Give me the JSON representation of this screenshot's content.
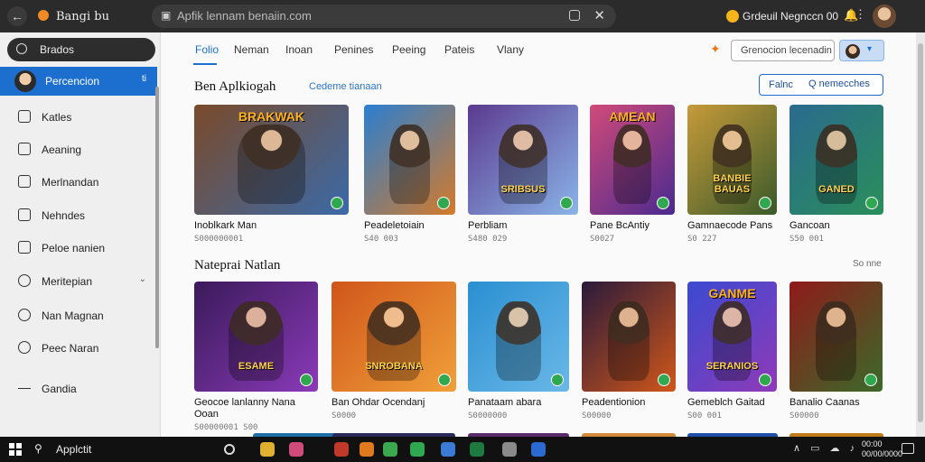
{
  "topbar": {
    "title": "Bangi  bu",
    "address": "Apfik lennam benaiin.com",
    "account": "Grdeuil Negnccn 00"
  },
  "sidebar": {
    "search": "Brados",
    "active": {
      "label": "Percencion",
      "badge": "ti"
    },
    "items": [
      {
        "label": "Katles"
      },
      {
        "label": "Aeaning"
      },
      {
        "label": "Merlnandan"
      },
      {
        "label": "Nehndes"
      },
      {
        "label": "Peloe nanien"
      },
      {
        "label": "Meritepian"
      },
      {
        "label": "Nan Magnan"
      },
      {
        "label": "Peec Naran"
      },
      {
        "label": "Gandia"
      }
    ]
  },
  "tabs": [
    "Folio",
    "Neman",
    "Inoan",
    "Penines",
    "Peeing",
    "Pateis",
    "Vlany"
  ],
  "header": {
    "search": "Grenocion lecenadin",
    "filter_label": "Falnc",
    "filter_value": "Q  nemecches"
  },
  "sections": [
    {
      "title": "Ben Aplkiogah",
      "subtitle": "Cedeme tianaan",
      "more": "",
      "cards": [
        {
          "name": "Inoblkark Man",
          "meta": "S000000001",
          "banner": "BRAKWAK",
          "art": "",
          "colors": [
            "#7a4a2a",
            "#3b6aa8"
          ]
        },
        {
          "name": "Peadeletoiain",
          "meta": "S40 003",
          "banner": "",
          "art": "",
          "colors": [
            "#2a7fd1",
            "#d47a2a"
          ]
        },
        {
          "name": "Perbliam",
          "meta": "S480 029",
          "banner": "",
          "art": "SRIBSUS",
          "colors": [
            "#5b3a8f",
            "#8ab4e8"
          ]
        },
        {
          "name": "Pane BcAntiy",
          "meta": "S0027",
          "banner": "AMEAN",
          "art": "",
          "colors": [
            "#d04a7a",
            "#4a2a8f"
          ]
        },
        {
          "name": "Gamnaecode Pans",
          "meta": "S0 227",
          "banner": "",
          "art": "BANBIE BAUAS",
          "colors": [
            "#c79a3a",
            "#3a5a2a"
          ]
        },
        {
          "name": "Gancoan",
          "meta": "S50 001",
          "banner": "",
          "art": "GANED",
          "colors": [
            "#2a6a8f",
            "#2a8f5a"
          ]
        }
      ]
    },
    {
      "title": "Nateprai Natlan",
      "subtitle": "",
      "more": "So nne",
      "cards": [
        {
          "name": "Geocoe lanlanny Nana Ooan",
          "meta": "S00000001 S00",
          "banner": "",
          "art": "ESAME",
          "colors": [
            "#3a1a5a",
            "#8a3ab8"
          ]
        },
        {
          "name": "Ban Ohdar Ocendanj",
          "meta": "S0000",
          "banner": "",
          "art": "SNROBANA",
          "colors": [
            "#d0561a",
            "#f0a03a"
          ]
        },
        {
          "name": "Panataam abara",
          "meta": "S0000000",
          "banner": "",
          "art": "",
          "colors": [
            "#2a8fd1",
            "#6ab8e8"
          ]
        },
        {
          "name": "Peadentionion",
          "meta": "S00000",
          "banner": "",
          "art": "",
          "colors": [
            "#2a1a3a",
            "#d0561a"
          ]
        },
        {
          "name": "Gemeblch Gaitad",
          "meta": "S00 001",
          "banner": "GANME",
          "art": "SERANIOS",
          "colors": [
            "#3a4ad1",
            "#8f3ab8"
          ]
        },
        {
          "name": "Banalio Caanas",
          "meta": "S00000",
          "banner": "",
          "art": "",
          "colors": [
            "#8f1a1a",
            "#3a6a2a"
          ]
        }
      ]
    }
  ],
  "taskbar": {
    "search": "Applctit",
    "clock_time": "00:00",
    "clock_date": "00/00/0000",
    "apps": [
      "#2d6cd1",
      "#e0b030",
      "#d04a7a",
      "#c0392b",
      "#e07a1f",
      "#3aa84f",
      "#2fa84f",
      "#3b7bd6",
      "#1e7a3e",
      "#8a8a8a",
      "#2a6ad1"
    ]
  }
}
